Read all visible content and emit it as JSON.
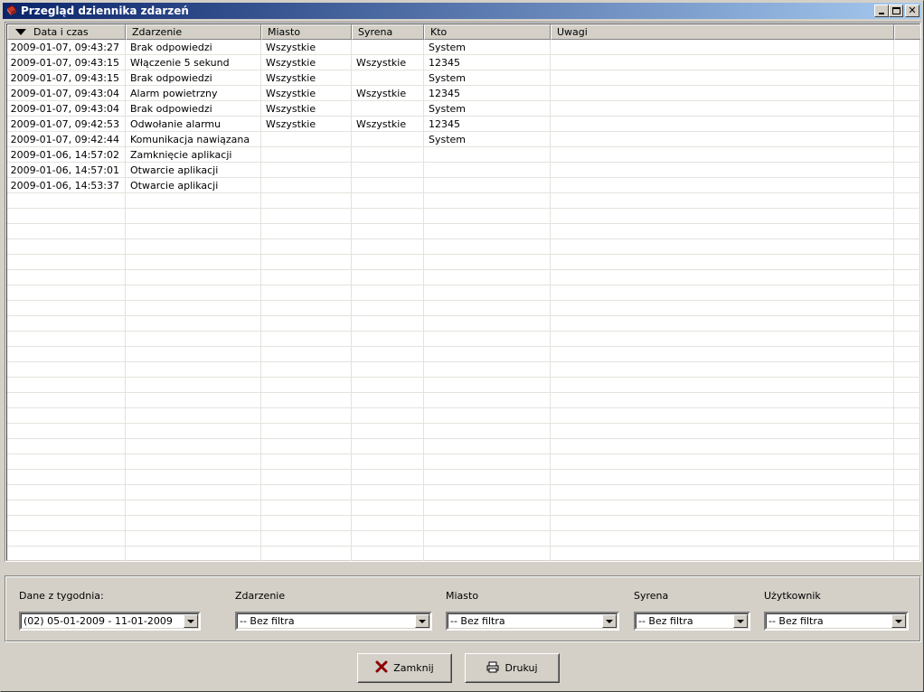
{
  "window": {
    "title": "Przegląd dziennika zdarzeń"
  },
  "grid": {
    "columns": [
      "Data i czas",
      "Zdarzenie",
      "Miasto",
      "Syrena",
      "Kto",
      "Uwagi"
    ],
    "rows": [
      [
        "2009-01-07, 09:43:27",
        "Brak odpowiedzi",
        "Wszystkie",
        "",
        "System",
        ""
      ],
      [
        "2009-01-07, 09:43:15",
        "Włączenie 5 sekund",
        "Wszystkie",
        "Wszystkie",
        "12345",
        ""
      ],
      [
        "2009-01-07, 09:43:15",
        "Brak odpowiedzi",
        "Wszystkie",
        "",
        "System",
        ""
      ],
      [
        "2009-01-07, 09:43:04",
        "Alarm powietrzny",
        "Wszystkie",
        "Wszystkie",
        "12345",
        ""
      ],
      [
        "2009-01-07, 09:43:04",
        "Brak odpowiedzi",
        "Wszystkie",
        "",
        "System",
        ""
      ],
      [
        "2009-01-07, 09:42:53",
        "Odwołanie alarmu",
        "Wszystkie",
        "Wszystkie",
        "12345",
        ""
      ],
      [
        "2009-01-07, 09:42:44",
        "Komunikacja nawiązana",
        "",
        "",
        "System",
        ""
      ],
      [
        "2009-01-06, 14:57:02",
        "Zamknięcie aplikacji",
        "",
        "",
        "",
        ""
      ],
      [
        "2009-01-06, 14:57:01",
        "Otwarcie aplikacji",
        "",
        "",
        "",
        ""
      ],
      [
        "2009-01-06, 14:53:37",
        "Otwarcie aplikacji",
        "",
        "",
        "",
        ""
      ]
    ]
  },
  "filters": {
    "week": {
      "label": "Dane z tygodnia:",
      "value": "(02)  05-01-2009 - 11-01-2009"
    },
    "event": {
      "label": "Zdarzenie",
      "value": "-- Bez filtra"
    },
    "city": {
      "label": "Miasto",
      "value": "-- Bez filtra"
    },
    "siren": {
      "label": "Syrena",
      "value": "-- Bez filtra"
    },
    "user": {
      "label": "Użytkownik",
      "value": "-- Bez filtra"
    }
  },
  "buttons": {
    "close": {
      "label": "Zamknij",
      "icon": "close-x-icon"
    },
    "print": {
      "label": "Drukuj",
      "icon": "printer-icon"
    }
  },
  "colors": {
    "title_start": "#0a246a",
    "title_end": "#a6caf0",
    "close_icon": "#8b0000"
  }
}
